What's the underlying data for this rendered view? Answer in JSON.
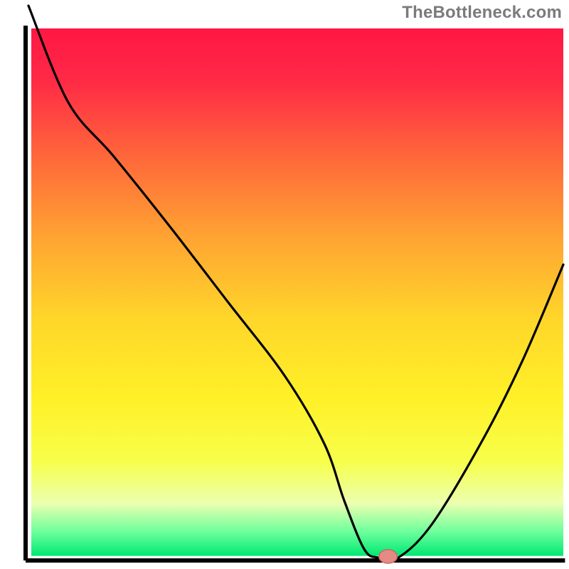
{
  "watermark": {
    "text": "TheBottleneck.com"
  },
  "chart_data": {
    "type": "line",
    "title": "",
    "xlabel": "",
    "ylabel": "",
    "xlim": [
      0,
      100
    ],
    "ylim": [
      0,
      100
    ],
    "axes": {
      "left": {
        "x": 4.5,
        "y0": 4.5,
        "y1": 98.5
      },
      "bottom": {
        "y": 98.5,
        "x0": 4.5,
        "x1": 99.3
      }
    },
    "gradient_stops": [
      {
        "offset": 0.0,
        "color": "#ff1744"
      },
      {
        "offset": 0.1,
        "color": "#ff2a46"
      },
      {
        "offset": 0.25,
        "color": "#ff6a3a"
      },
      {
        "offset": 0.4,
        "color": "#ffa532"
      },
      {
        "offset": 0.55,
        "color": "#ffd62a"
      },
      {
        "offset": 0.7,
        "color": "#fff028"
      },
      {
        "offset": 0.82,
        "color": "#f7ff4a"
      },
      {
        "offset": 0.9,
        "color": "#ecffb0"
      },
      {
        "offset": 0.955,
        "color": "#6bff9c"
      },
      {
        "offset": 1.0,
        "color": "#00e873"
      }
    ],
    "gradient_rect": {
      "x": 5.5,
      "y": 5.0,
      "w": 93.5,
      "h": 92.7
    },
    "series": [
      {
        "name": "bottleneck-curve",
        "x": [
          5.0,
          12.0,
          20.0,
          30.0,
          40.0,
          50.0,
          57.0,
          60.5,
          64.0,
          66.5,
          70.0,
          76.0,
          85.0,
          92.0,
          99.0
        ],
        "values": [
          99.0,
          82.0,
          72.5,
          60.0,
          47.0,
          34.0,
          22.0,
          12.0,
          3.5,
          2.0,
          2.0,
          8.0,
          23.0,
          37.0,
          53.5
        ]
      }
    ],
    "marker": {
      "name": "optimal-point",
      "x": 68.2,
      "y": 2.2,
      "rx": 1.6,
      "ry": 1.2,
      "fill": "#e58a84",
      "stroke": "#c96a63"
    }
  }
}
